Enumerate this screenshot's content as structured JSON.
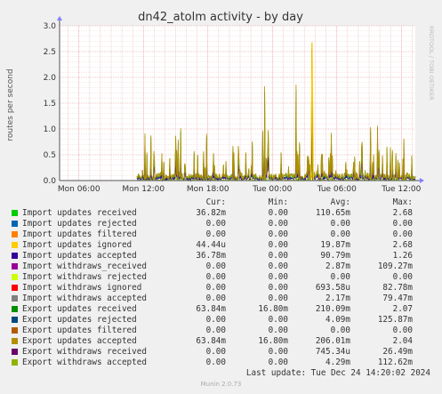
{
  "chart_data": {
    "type": "line",
    "title": "dn42_atolm activity - by day",
    "ylabel": "routes per second",
    "xlabel": "",
    "ylim": [
      0,
      3.0
    ],
    "y_ticks": [
      "0.0",
      "0.5",
      "1.0",
      "1.5",
      "2.0",
      "2.5",
      "3.0"
    ],
    "x_ticks": [
      "Mon 06:00",
      "Mon 12:00",
      "Mon 18:00",
      "Tue 00:00",
      "Tue 06:00",
      "Tue 12:00"
    ],
    "x_tick_hours": [
      6,
      12,
      18,
      24,
      30,
      36
    ],
    "x_range_hours": [
      4.2,
      37.3
    ],
    "data_start_hour": 11.4,
    "grid": true,
    "peaks": [
      {
        "series": "Import updates ignored",
        "hour": 27.7,
        "value": 2.68
      },
      {
        "series": "Export updates accepted",
        "hour": 27.7,
        "value": 2.04
      },
      {
        "series": "Export updates accepted",
        "hour": 26.2,
        "value": 1.85
      },
      {
        "series": "Export updates accepted",
        "hour": 23.3,
        "value": 1.82
      }
    ]
  },
  "watermark": "RRDTOOL / TOBI OETIKER",
  "legend": {
    "headers": {
      "cur": "Cur:",
      "min": "Min:",
      "avg": "Avg:",
      "max": "Max:"
    },
    "items": [
      {
        "label": "Import updates received",
        "color": "#00cc00",
        "cur": "36.82m",
        "min": "0.00",
        "avg": "110.65m",
        "max": "2.68"
      },
      {
        "label": "Import updates rejected",
        "color": "#0066b3",
        "cur": "0.00",
        "min": "0.00",
        "avg": "0.00",
        "max": "0.00"
      },
      {
        "label": "Import updates filtered",
        "color": "#ff8000",
        "cur": "0.00",
        "min": "0.00",
        "avg": "0.00",
        "max": "0.00"
      },
      {
        "label": "Import updates ignored",
        "color": "#ffcc00",
        "cur": "44.44u",
        "min": "0.00",
        "avg": "19.87m",
        "max": "2.68"
      },
      {
        "label": "Import updates accepted",
        "color": "#330099",
        "cur": "36.78m",
        "min": "0.00",
        "avg": "90.79m",
        "max": "1.26"
      },
      {
        "label": "Import withdraws_received",
        "color": "#990099",
        "cur": "0.00",
        "min": "0.00",
        "avg": "2.87m",
        "max": "109.27m"
      },
      {
        "label": "Import withdraws rejected",
        "color": "#ccff00",
        "cur": "0.00",
        "min": "0.00",
        "avg": "0.00",
        "max": "0.00"
      },
      {
        "label": "Import withdraws ignored",
        "color": "#ff0000",
        "cur": "0.00",
        "min": "0.00",
        "avg": "693.58u",
        "max": "82.78m"
      },
      {
        "label": "Import withdraws accepted",
        "color": "#808080",
        "cur": "0.00",
        "min": "0.00",
        "avg": "2.17m",
        "max": "79.47m"
      },
      {
        "label": "Export updates received",
        "color": "#008f00",
        "cur": "63.84m",
        "min": "16.80m",
        "avg": "210.09m",
        "max": "2.07"
      },
      {
        "label": "Export updates rejected",
        "color": "#00487d",
        "cur": "0.00",
        "min": "0.00",
        "avg": "4.09m",
        "max": "125.87m"
      },
      {
        "label": "Export updates filtered",
        "color": "#b35a00",
        "cur": "0.00",
        "min": "0.00",
        "avg": "0.00",
        "max": "0.00"
      },
      {
        "label": "Export updates accepted",
        "color": "#b38f00",
        "cur": "63.84m",
        "min": "16.80m",
        "avg": "206.01m",
        "max": "2.04"
      },
      {
        "label": "Export withdraws received",
        "color": "#6b006b",
        "cur": "0.00",
        "min": "0.00",
        "avg": "745.34u",
        "max": "26.49m"
      },
      {
        "label": "Export withdraws accepted",
        "color": "#8fb300",
        "cur": "0.00",
        "min": "0.00",
        "avg": "4.29m",
        "max": "112.62m"
      }
    ]
  },
  "last_update": "Last update: Tue Dec 24 14:20:02 2024",
  "munin_version": "Munin 2.0.73"
}
